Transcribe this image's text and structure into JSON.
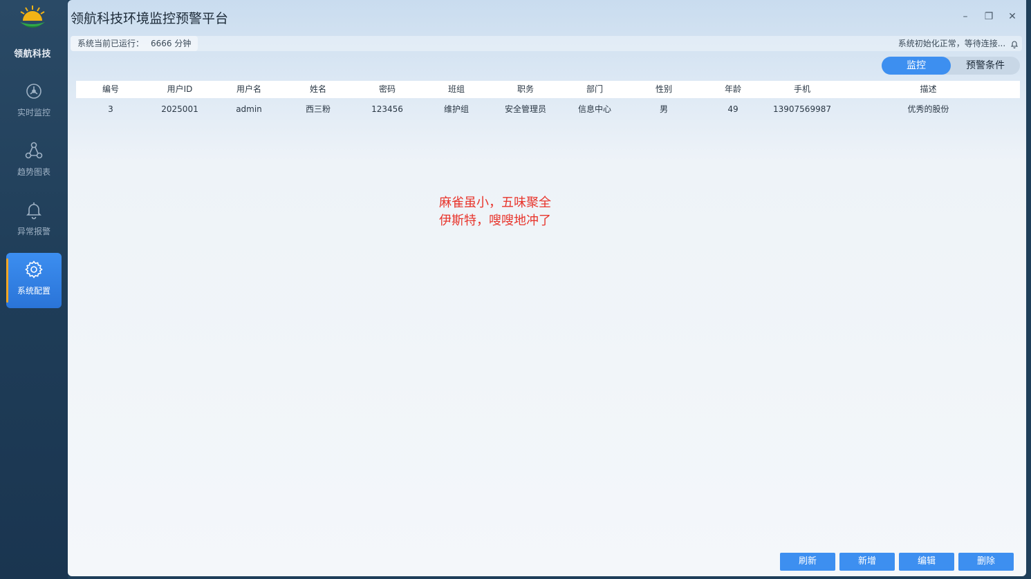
{
  "sidebar": {
    "brand": "领航科技",
    "items": [
      {
        "label": "实时监控",
        "icon": "monitor-icon"
      },
      {
        "label": "趋势图表",
        "icon": "chart-nodes-icon"
      },
      {
        "label": "异常报警",
        "icon": "bell-icon"
      },
      {
        "label": "系统配置",
        "icon": "gear-icon",
        "active": true
      }
    ]
  },
  "window": {
    "title": "领航科技环境监控预警平台",
    "controls": {
      "minimize": "–",
      "restore": "❐",
      "close": "✕"
    }
  },
  "status": {
    "runtime_label": "系统当前已运行：",
    "runtime_value": "6666 分钟",
    "system_status": "系统初始化正常，等待连接..."
  },
  "tabs": [
    {
      "label": "监控",
      "active": true
    },
    {
      "label": "预警条件",
      "active": false
    }
  ],
  "table": {
    "columns": [
      "编号",
      "用户ID",
      "用户名",
      "姓名",
      "密码",
      "班组",
      "职务",
      "部门",
      "性别",
      "年龄",
      "手机",
      "描述"
    ],
    "rows": [
      [
        "3",
        "2025001",
        "admin",
        "西三粉",
        "123456",
        "维护组",
        "安全管理员",
        "信息中心",
        "男",
        "49",
        "13907569987",
        "优秀的股份"
      ]
    ]
  },
  "note": {
    "line1": "麻雀虽小，五味聚全",
    "line2": "伊斯特，嗖嗖地冲了"
  },
  "buttons": {
    "refresh": "刷新",
    "add": "新增",
    "edit": "编辑",
    "delete": "删除"
  },
  "colors": {
    "accent": "#3d8ff0",
    "sidebar": "#1f3d58",
    "note": "#e8352c"
  }
}
